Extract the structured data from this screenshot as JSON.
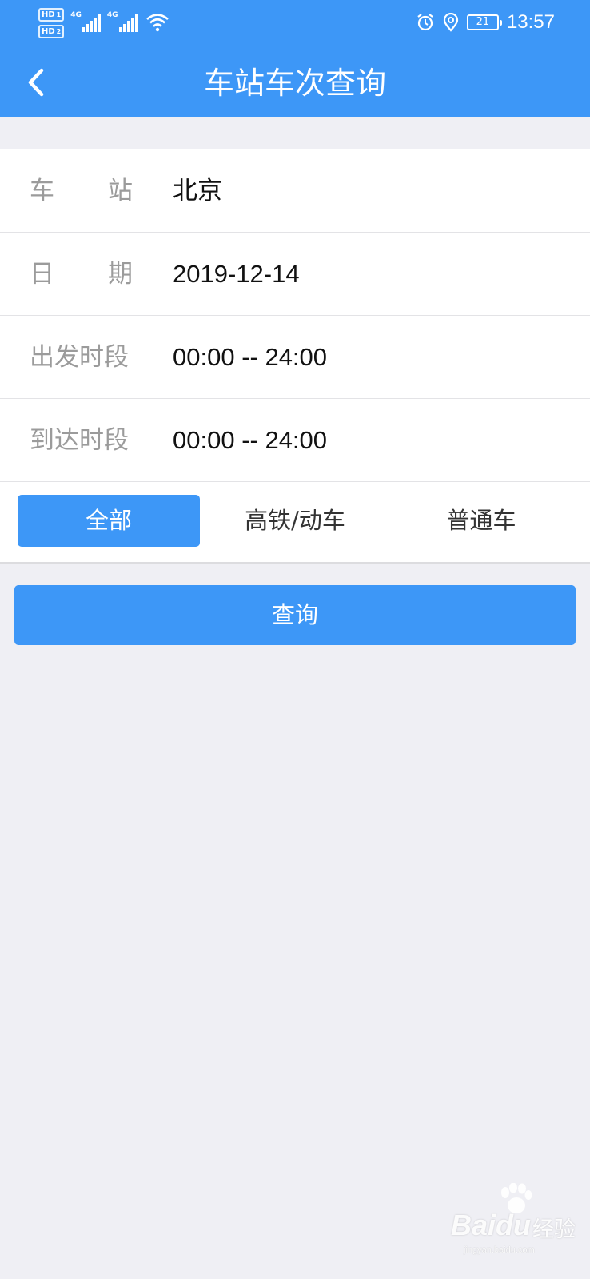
{
  "status_bar": {
    "hd1": "HD",
    "hd1_sub": "1",
    "hd2": "HD",
    "hd2_sub": "2",
    "network1": "4G",
    "network2": "4G",
    "battery": "21",
    "time": "13:57",
    "icons": [
      "alarm-icon",
      "location-icon",
      "wifi-icon",
      "signal-icon"
    ]
  },
  "header": {
    "title": "车站车次查询",
    "back_icon": "chevron-left-icon"
  },
  "form": {
    "station": {
      "label_a": "车",
      "label_b": "站",
      "value": "北京"
    },
    "date": {
      "label_a": "日",
      "label_b": "期",
      "value": "2019-12-14"
    },
    "depart": {
      "label": "出发时段",
      "value": "00:00 -- 24:00"
    },
    "arrive": {
      "label": "到达时段",
      "value": "00:00 -- 24:00"
    }
  },
  "train_types": {
    "options": [
      "全部",
      "高铁/动车",
      "普通车"
    ],
    "selected": "全部"
  },
  "query_button": "查询",
  "watermark": {
    "brand": "Bai",
    "brand_suffix": "du",
    "cn": "经验",
    "url": "jingyan.baidu.com"
  },
  "colors": {
    "primary": "#3d97f7",
    "background": "#efeff4",
    "label": "#9b9b9b"
  }
}
